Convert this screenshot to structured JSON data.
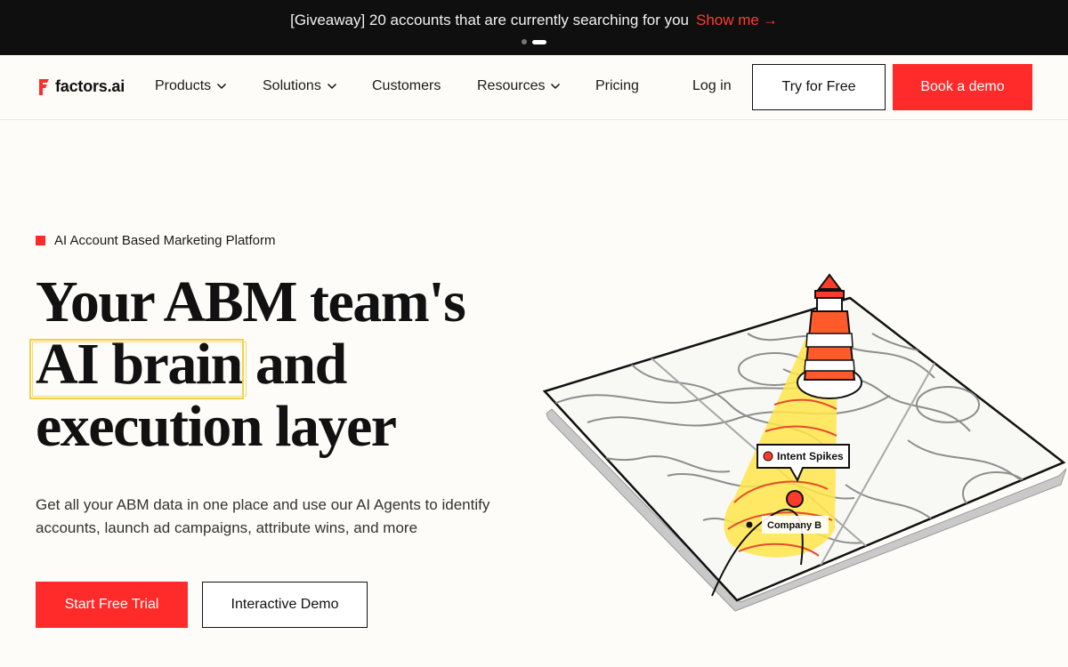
{
  "announcement": {
    "text": "[Giveaway] 20 accounts that are currently searching for you",
    "cta": "Show me",
    "arrow": "→",
    "slides": 2,
    "active_slide": 2
  },
  "nav": {
    "logo_text": "factors.ai",
    "items": [
      {
        "label": "Products",
        "has_dropdown": true
      },
      {
        "label": "Solutions",
        "has_dropdown": true
      },
      {
        "label": "Customers",
        "has_dropdown": false
      },
      {
        "label": "Resources",
        "has_dropdown": true
      },
      {
        "label": "Pricing",
        "has_dropdown": false
      }
    ],
    "login": "Log in",
    "try_free": "Try for Free",
    "book_demo": "Book a demo"
  },
  "hero": {
    "eyebrow": "AI Account Based Marketing Platform",
    "headline_line1": "Your ABM team's",
    "headline_highlight": "AI brain",
    "headline_line2_rest": " and",
    "headline_line3": "execution layer",
    "subtext": "Get all your ABM data in one place and use our AI Agents to identify accounts, launch ad campaigns, attribute wins, and more",
    "primary_cta": "Start Free Trial",
    "secondary_cta": "Interactive Demo"
  },
  "illustration": {
    "intent_label": "Intent Spikes",
    "company_label": "Company B"
  },
  "colors": {
    "accent": "#ff2a2a",
    "announcement_bg": "#0f0f0f",
    "page_bg": "#fdfcf8",
    "highlight": "#f3d04a",
    "beam": "#ffe54a"
  }
}
